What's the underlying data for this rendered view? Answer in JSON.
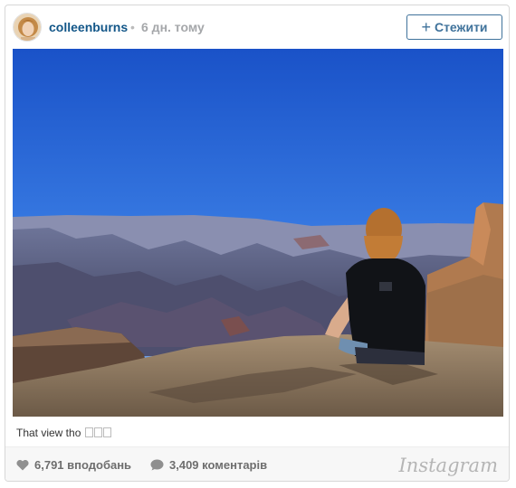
{
  "post": {
    "username": "colleenburns",
    "separator": "•",
    "time_ago": "6 дн. тому",
    "follow_label": "Стежити",
    "follow_icon": "plus-icon",
    "photo_alt": "Grand Canyon",
    "caption_text": "That view tho ",
    "caption_emoji_count": 3
  },
  "footer": {
    "likes_text": "6,791 вподобань",
    "likes_icon": "heart-icon",
    "comments_text": "3,409 коментарів",
    "comments_icon": "speech-bubble-icon",
    "brand": "Instagram"
  },
  "colors": {
    "username": "#125688",
    "follow_button": "#3f729b",
    "sky": "#1d5fd4",
    "muted_text": "#6e6e6e"
  }
}
